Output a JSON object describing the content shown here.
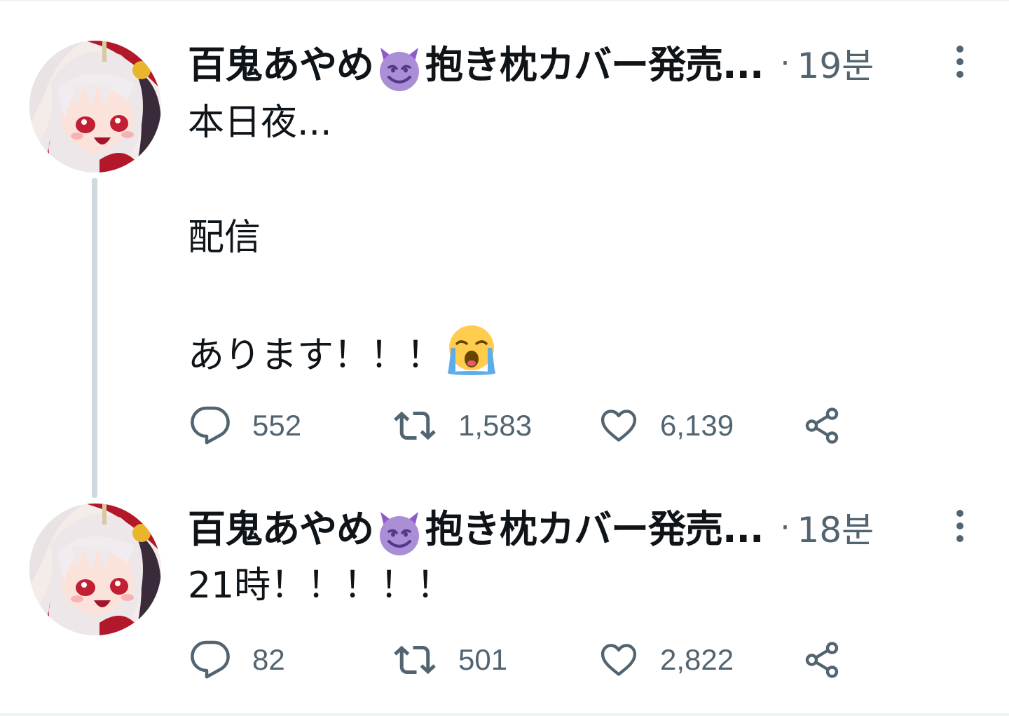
{
  "tweets": [
    {
      "author": {
        "display_name_part1": "百鬼あやめ",
        "display_name_part2": "抱き枕カバー発売...",
        "name_emoji": "smiling-devil-emoji"
      },
      "timestamp": "19분",
      "separator": "·",
      "body": "本日夜...\n\n配信\n\nあります！！！",
      "body_emoji": "loudly-crying-face-emoji",
      "stats": {
        "replies": "552",
        "retweets": "1,583",
        "likes": "6,139"
      }
    },
    {
      "author": {
        "display_name_part1": "百鬼あやめ",
        "display_name_part2": "抱き枕カバー発売...",
        "name_emoji": "smiling-devil-emoji"
      },
      "timestamp": "18분",
      "separator": "·",
      "body": "21時！！！！！",
      "stats": {
        "replies": "82",
        "retweets": "501",
        "likes": "2,822"
      }
    }
  ],
  "colors": {
    "text_primary": "#0f1419",
    "text_secondary": "#536471",
    "thread_line": "#cfd9de",
    "devil_emoji": "#8e5cc8",
    "crying_emoji": "#ffcc4d",
    "tears": "#5dadec"
  },
  "icons": [
    "reply-icon",
    "retweet-icon",
    "like-icon",
    "share-icon",
    "more-icon"
  ]
}
